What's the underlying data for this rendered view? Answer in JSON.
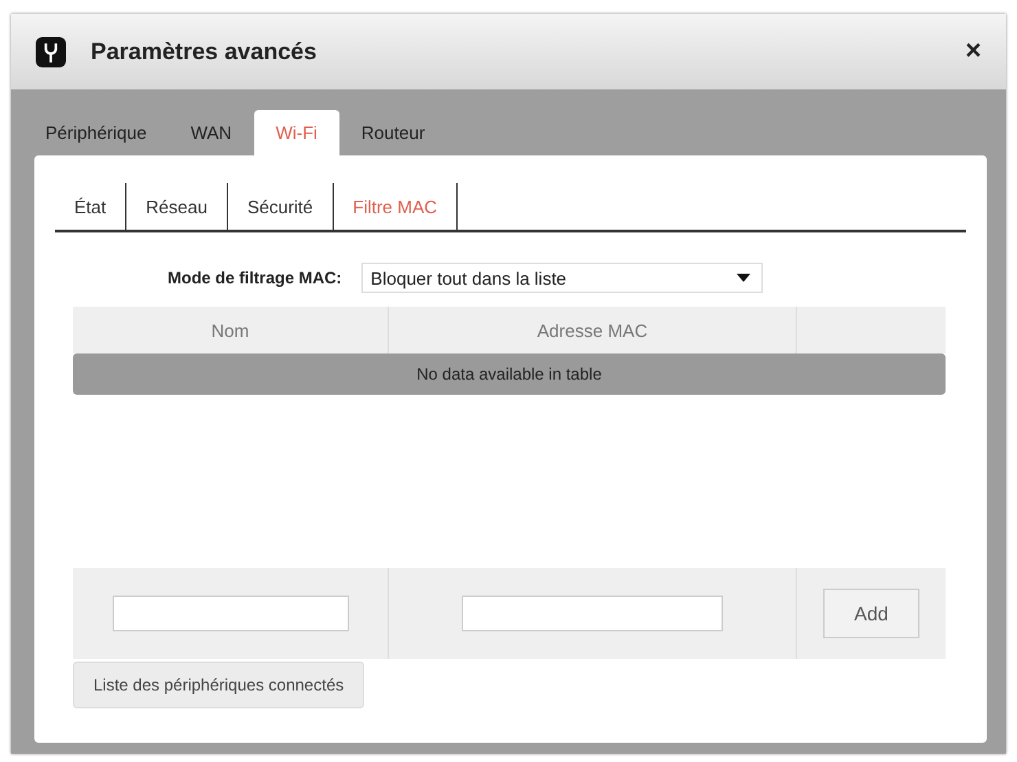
{
  "window": {
    "title": "Paramètres avancés",
    "close": "×"
  },
  "tabs": [
    {
      "label": "Périphérique",
      "selected": false
    },
    {
      "label": "WAN",
      "selected": false
    },
    {
      "label": "Wi-Fi",
      "selected": true
    },
    {
      "label": "Routeur",
      "selected": false
    }
  ],
  "subtabs": [
    {
      "label": "État",
      "selected": false
    },
    {
      "label": "Réseau",
      "selected": false
    },
    {
      "label": "Sécurité",
      "selected": false
    },
    {
      "label": "Filtre MAC",
      "selected": true
    }
  ],
  "filter_mode": {
    "label": "Mode de filtrage MAC:",
    "value": "Bloquer tout dans la liste"
  },
  "table": {
    "columns": [
      "Nom",
      "Adresse MAC"
    ],
    "empty_message": "No data available in table"
  },
  "add_row": {
    "button": "Add"
  },
  "connected_devices_button": "Liste des périphériques connectés"
}
